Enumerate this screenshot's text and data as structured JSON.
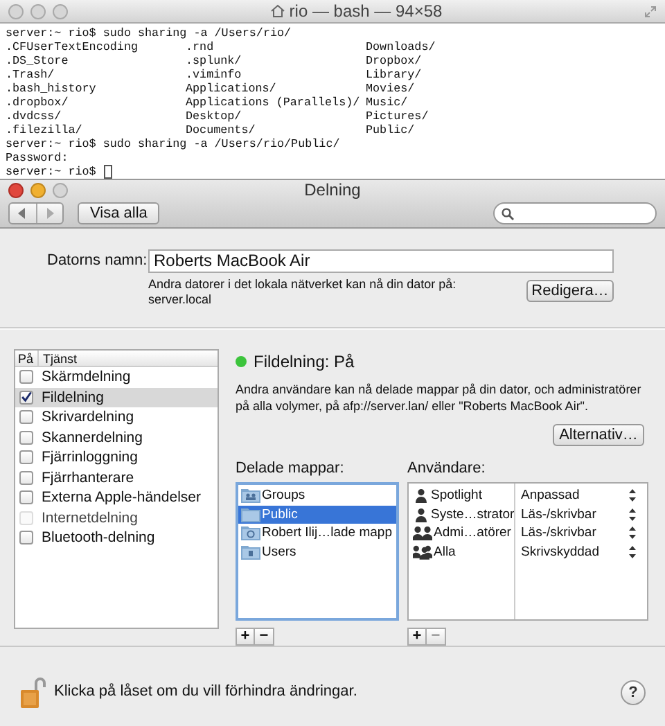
{
  "terminal": {
    "title": "rio — bash — 94×58",
    "lines": [
      {
        "kind": "text",
        "text": "server:~ rio$ sudo sharing -a /Users/rio/"
      },
      {
        "kind": "columns",
        "cells": [
          ".CFUserTextEncoding",
          ".rnd",
          "Downloads/"
        ]
      },
      {
        "kind": "columns",
        "cells": [
          ".DS_Store",
          ".splunk/",
          "Dropbox/"
        ]
      },
      {
        "kind": "columns",
        "cells": [
          ".Trash/",
          ".viminfo",
          "Library/"
        ]
      },
      {
        "kind": "columns",
        "cells": [
          ".bash_history",
          "Applications/",
          "Movies/"
        ]
      },
      {
        "kind": "columns",
        "cells": [
          ".dropbox/",
          "Applications (Parallels)/",
          "Music/"
        ]
      },
      {
        "kind": "columns",
        "cells": [
          ".dvdcss/",
          "Desktop/",
          "Pictures/"
        ]
      },
      {
        "kind": "columns",
        "cells": [
          ".filezilla/",
          "Documents/",
          "Public/"
        ]
      },
      {
        "kind": "text",
        "text": "server:~ rio$ sudo sharing -a /Users/rio/Public/"
      },
      {
        "kind": "text",
        "text": "Password:"
      },
      {
        "kind": "prompt",
        "text": "server:~ rio$"
      }
    ]
  },
  "window": {
    "title": "Delning",
    "show_all": "Visa alla"
  },
  "computer_name": {
    "label": "Datorns namn:",
    "value": "Roberts MacBook Air",
    "note": "Andra datorer i det lokala nätverket kan nå din dator på:",
    "address": "server.local",
    "edit_button": "Redigera…"
  },
  "services": {
    "columns": [
      "På",
      "Tjänst"
    ],
    "items": [
      {
        "label": "Skärmdelning",
        "checked": false,
        "selected": false,
        "disabled": false
      },
      {
        "label": "Fildelning",
        "checked": true,
        "selected": true,
        "disabled": false
      },
      {
        "label": "Skrivardelning",
        "checked": false,
        "selected": false,
        "disabled": false
      },
      {
        "label": "Skannerdelning",
        "checked": false,
        "selected": false,
        "disabled": false
      },
      {
        "label": "Fjärrinloggning",
        "checked": false,
        "selected": false,
        "disabled": false
      },
      {
        "label": "Fjärrhanterare",
        "checked": false,
        "selected": false,
        "disabled": false
      },
      {
        "label": "Externa Apple-händelser",
        "checked": false,
        "selected": false,
        "disabled": false
      },
      {
        "label": "Internetdelning",
        "checked": false,
        "selected": false,
        "disabled": true
      },
      {
        "label": "Bluetooth-delning",
        "checked": false,
        "selected": false,
        "disabled": false
      }
    ]
  },
  "status": {
    "text": "Fildelning: På",
    "color": "#3cc43c",
    "description": "Andra användare kan nå delade mappar på din dator, och administratörer på alla volymer, på afp://server.lan/ eller \"Roberts MacBook Air\".",
    "options_button": "Alternativ…"
  },
  "shared_folders": {
    "label": "Delade mappar:",
    "items": [
      {
        "name": "Groups",
        "kind": "group",
        "selected": false
      },
      {
        "name": "Public",
        "kind": "plain",
        "selected": true
      },
      {
        "name": "Robert Ilij…lade mapp",
        "kind": "shared",
        "selected": false
      },
      {
        "name": "Users",
        "kind": "users",
        "selected": false
      }
    ],
    "add": "+",
    "remove": "−"
  },
  "users": {
    "label": "Användare:",
    "items": [
      {
        "name": "Spotlight",
        "kind": "user",
        "permission": "Anpassad"
      },
      {
        "name": "Syste…strator",
        "kind": "user",
        "permission": "Läs-/skrivbar"
      },
      {
        "name": "Admi…atörer",
        "kind": "group",
        "permission": "Läs-/skrivbar"
      },
      {
        "name": "Alla",
        "kind": "everyone",
        "permission": "Skrivskyddad"
      }
    ],
    "add": "+",
    "remove": "−"
  },
  "footer": {
    "lock_text": "Klicka på låset om du vill förhindra ändringar.",
    "help": "?"
  }
}
